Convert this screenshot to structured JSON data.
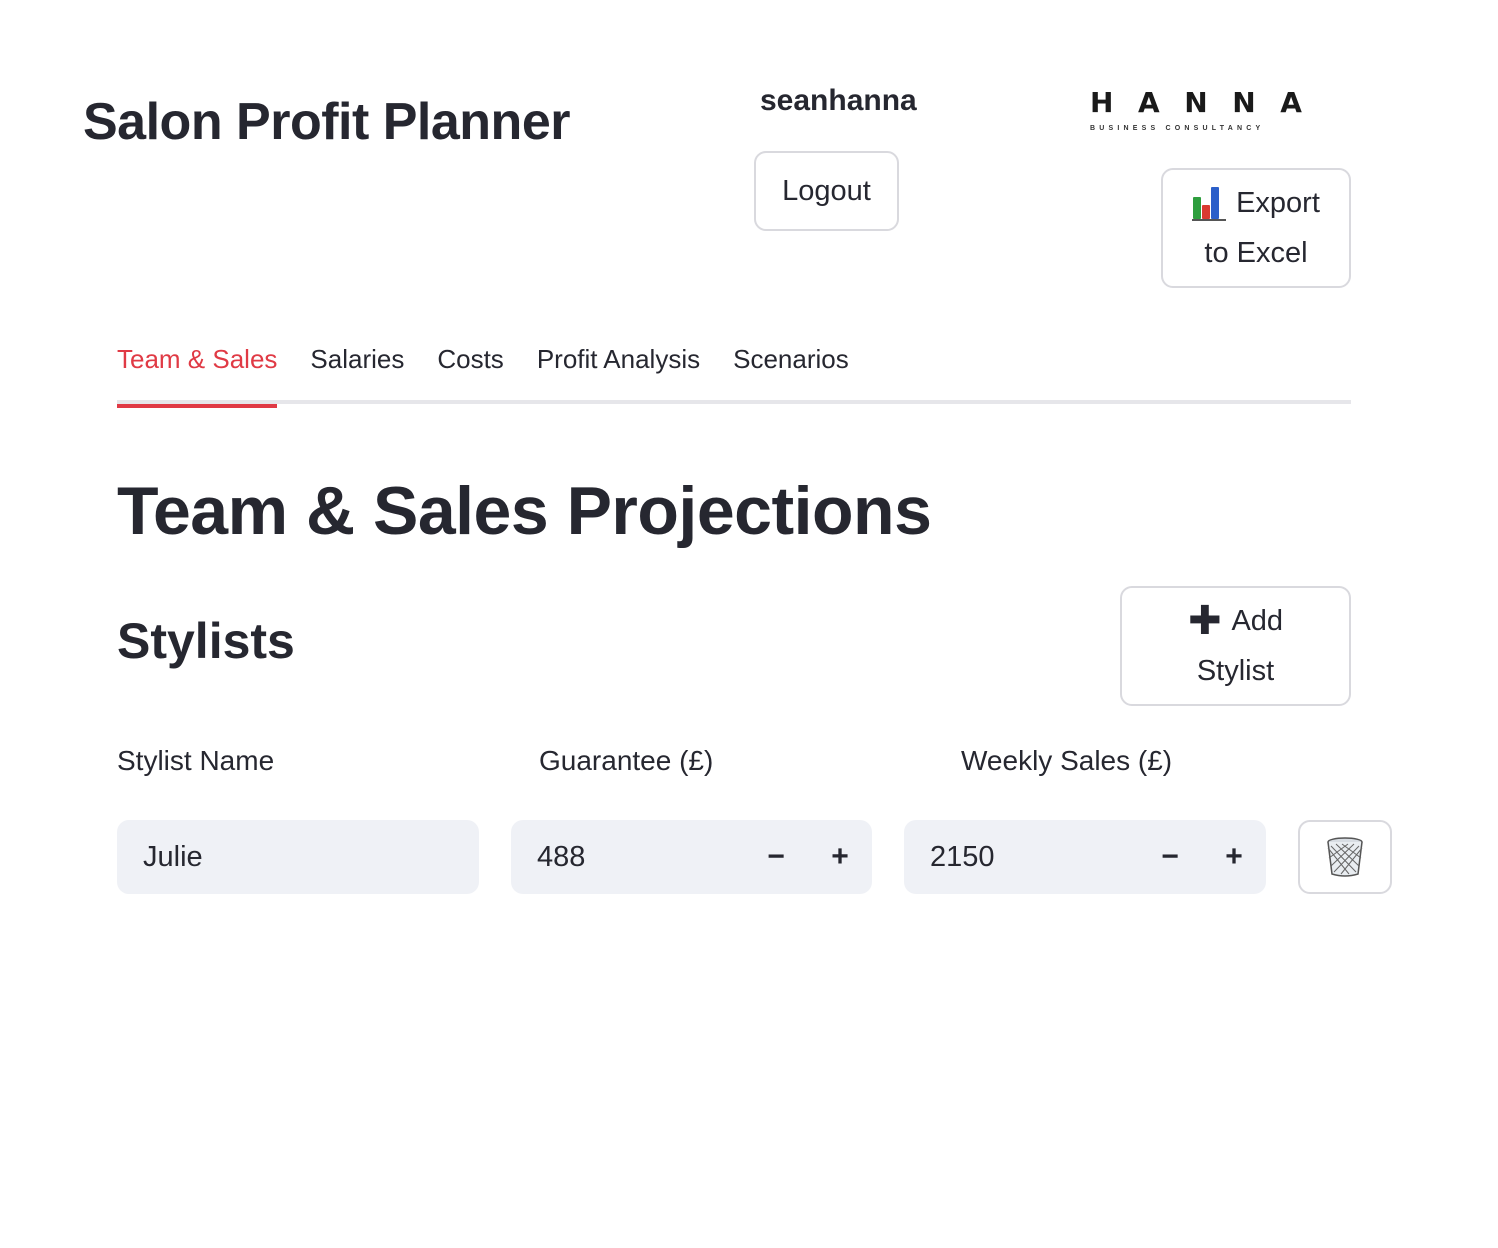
{
  "header": {
    "title": "Salon Profit Planner",
    "username": "seanhanna",
    "logout_label": "Logout",
    "logo": {
      "letters": [
        "H",
        "A",
        "N",
        "N",
        "A"
      ],
      "tagline": "BUSINESS CONSULTANCY"
    },
    "export": {
      "line1": "Export",
      "line2": "to Excel",
      "icon": "bar-chart-icon"
    }
  },
  "tabs": [
    {
      "label": "Team & Sales",
      "active": true
    },
    {
      "label": "Salaries",
      "active": false
    },
    {
      "label": "Costs",
      "active": false
    },
    {
      "label": "Profit Analysis",
      "active": false
    },
    {
      "label": "Scenarios",
      "active": false
    }
  ],
  "main": {
    "section_title": "Team & Sales Projections",
    "stylists_heading": "Stylists",
    "add_button": {
      "line1": "Add",
      "line2": "Stylist",
      "icon": "plus-icon"
    },
    "columns": {
      "name": "Stylist Name",
      "guarantee": "Guarantee (£)",
      "weekly_sales": "Weekly Sales (£)"
    },
    "rows": [
      {
        "name": "Julie",
        "guarantee": "488",
        "weekly_sales": "2150",
        "delete_icon": "trash-icon"
      }
    ],
    "stepper": {
      "minus": "−",
      "plus": "+"
    }
  },
  "colors": {
    "accent": "#e03a45",
    "text": "#262730",
    "input_bg": "#eff1f6",
    "border": "#d9d9de"
  }
}
